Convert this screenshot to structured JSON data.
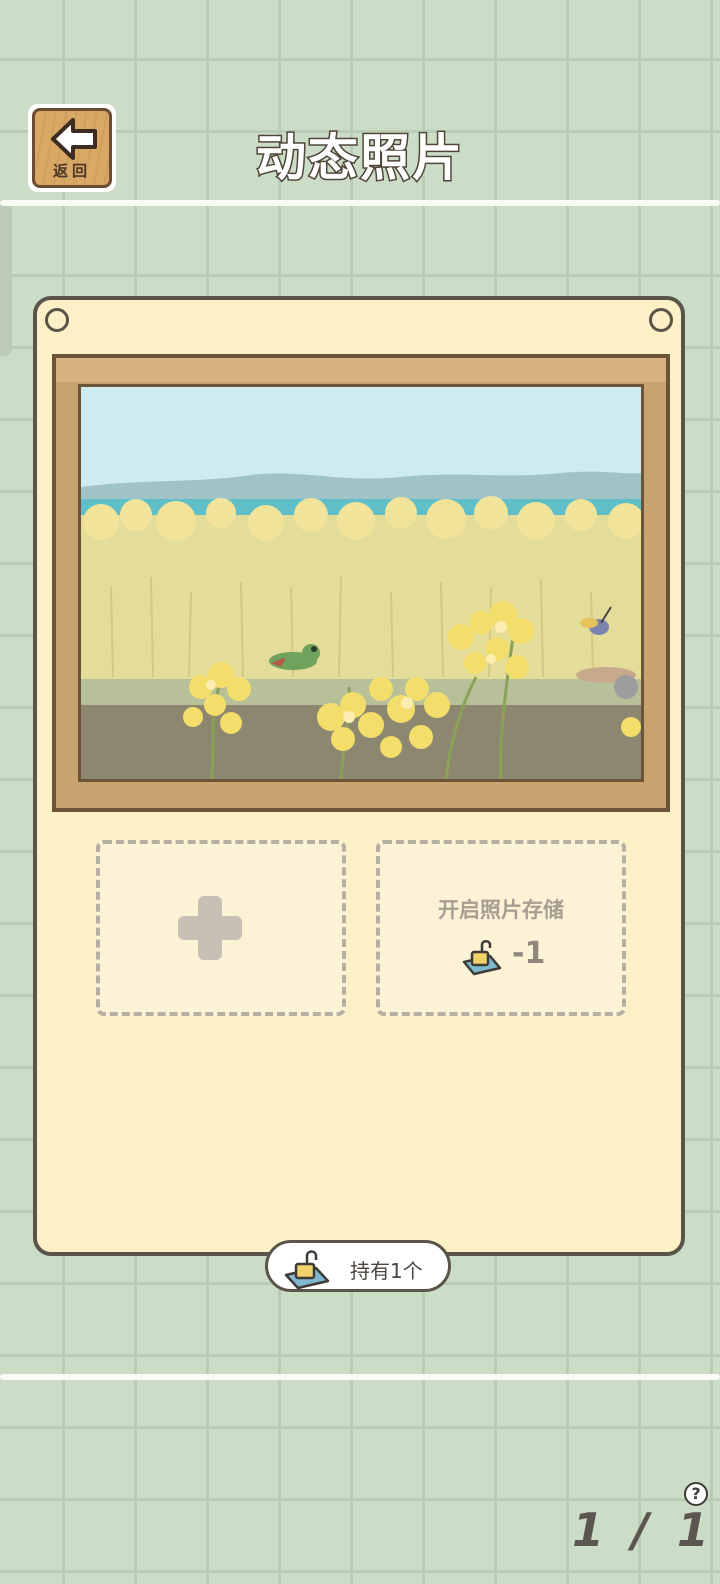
{
  "header": {
    "back_label": "返回",
    "title": "动态照片"
  },
  "photo_slots": {
    "add_slot": {
      "icon": "plus-icon"
    },
    "locked_slot": {
      "label": "开启照片存储",
      "cost": "-1",
      "icon": "unlock-ticket-icon"
    }
  },
  "holding": {
    "label": "持有1个",
    "icon": "unlock-ticket-icon"
  },
  "pager": {
    "current": "1",
    "total": "1",
    "separator": "/"
  },
  "help": {
    "icon": "help-icon",
    "label": "?"
  },
  "colors": {
    "background": "#cbdcc7",
    "card": "#fbf0c6",
    "outline": "#5b5449",
    "frame_wood": "#c9a36f"
  }
}
